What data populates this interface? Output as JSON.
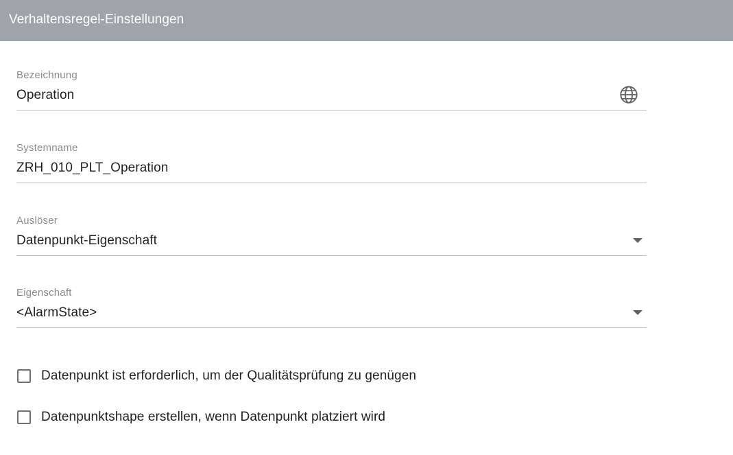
{
  "header": {
    "title": "Verhaltensregel-Einstellungen"
  },
  "fields": {
    "bezeichnung": {
      "label": "Bezeichnung",
      "value": "Operation",
      "icon": "globe-icon"
    },
    "systemname": {
      "label": "Systemname",
      "value": "ZRH_010_PLT_Operation"
    },
    "ausloeser": {
      "label": "Auslöser",
      "value": "Datenpunkt-Eigenschaft",
      "icon": "chevron-down-icon"
    },
    "eigenschaft": {
      "label": "Eigenschaft",
      "value": "<AlarmState>",
      "icon": "chevron-down-icon"
    }
  },
  "checkboxes": [
    {
      "label": "Datenpunkt ist erforderlich, um der Qualitätsprüfung zu genügen",
      "checked": false
    },
    {
      "label": "Datenpunktshape erstellen, wenn Datenpunkt platziert wird",
      "checked": false
    }
  ],
  "colors": {
    "header_bg": "#a0a3aa",
    "underline": "#bdbdbd",
    "label": "#8a8a8a",
    "text": "#222222"
  }
}
